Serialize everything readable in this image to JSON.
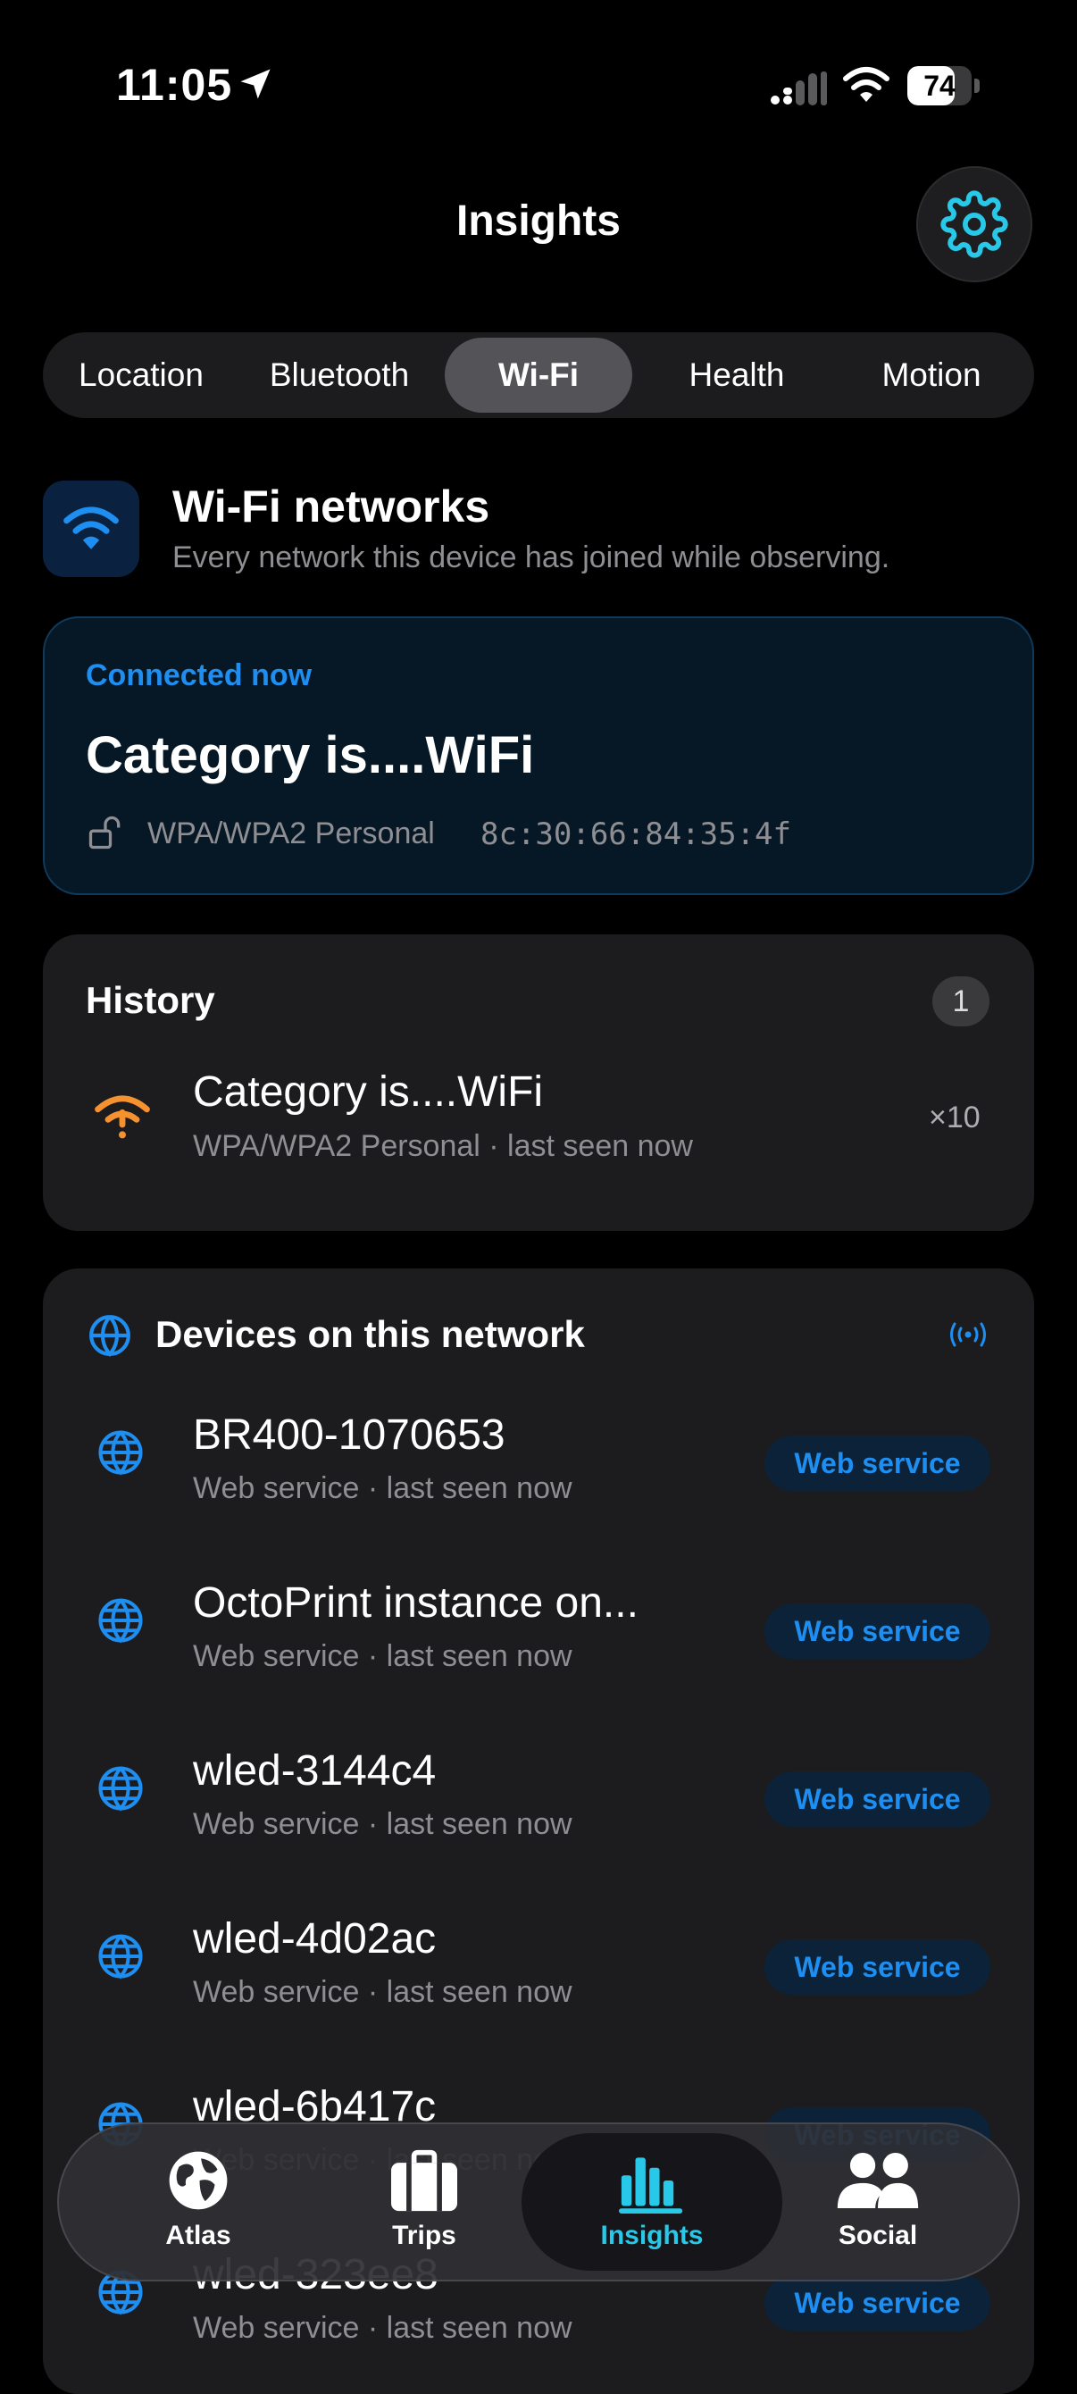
{
  "status_bar": {
    "time": "11:05",
    "battery": "74",
    "battery_level": 0.74
  },
  "header": {
    "title": "Insights"
  },
  "segments": [
    "Location",
    "Bluetooth",
    "Wi-Fi",
    "Health",
    "Motion"
  ],
  "active_segment": "Wi-Fi",
  "section": {
    "title": "Wi-Fi networks",
    "subtitle": "Every network this device has joined while observing."
  },
  "connected": {
    "label": "Connected now",
    "name": "Category is....WiFi",
    "security": "WPA/WPA2 Personal",
    "mac": "8c:30:66:84:35:4f"
  },
  "history": {
    "title": "History",
    "count": "1",
    "items": [
      {
        "name": "Category is....WiFi",
        "subtitle": "WPA/WPA2 Personal · last seen now",
        "times": "×10"
      }
    ]
  },
  "devices": {
    "title": "Devices on this network",
    "items": [
      {
        "name": "BR400-1070653",
        "subtitle": "Web service · last seen now",
        "badge": "Web service"
      },
      {
        "name": "OctoPrint instance on...",
        "subtitle": "Web service · last seen now",
        "badge": "Web service"
      },
      {
        "name": "wled-3144c4",
        "subtitle": "Web service · last seen now",
        "badge": "Web service"
      },
      {
        "name": "wled-4d02ac",
        "subtitle": "Web service · last seen now",
        "badge": "Web service"
      },
      {
        "name": "wled-6b417c",
        "subtitle": "Web service · last seen now",
        "badge": "Web service"
      },
      {
        "name": "wled-323ee8",
        "subtitle": "Web service · last seen now",
        "badge": "Web service"
      }
    ]
  },
  "tabbar": {
    "tabs": [
      {
        "label": "Atlas",
        "icon": "globe-icon"
      },
      {
        "label": "Trips",
        "icon": "suitcase-icon"
      },
      {
        "label": "Insights",
        "icon": "bar-chart-icon"
      },
      {
        "label": "Social",
        "icon": "people-icon"
      }
    ],
    "active": "Insights"
  },
  "colors": {
    "accent": "#1e8ef0",
    "tab_accent": "#28c8e8",
    "history_icon": "#f5922f"
  }
}
